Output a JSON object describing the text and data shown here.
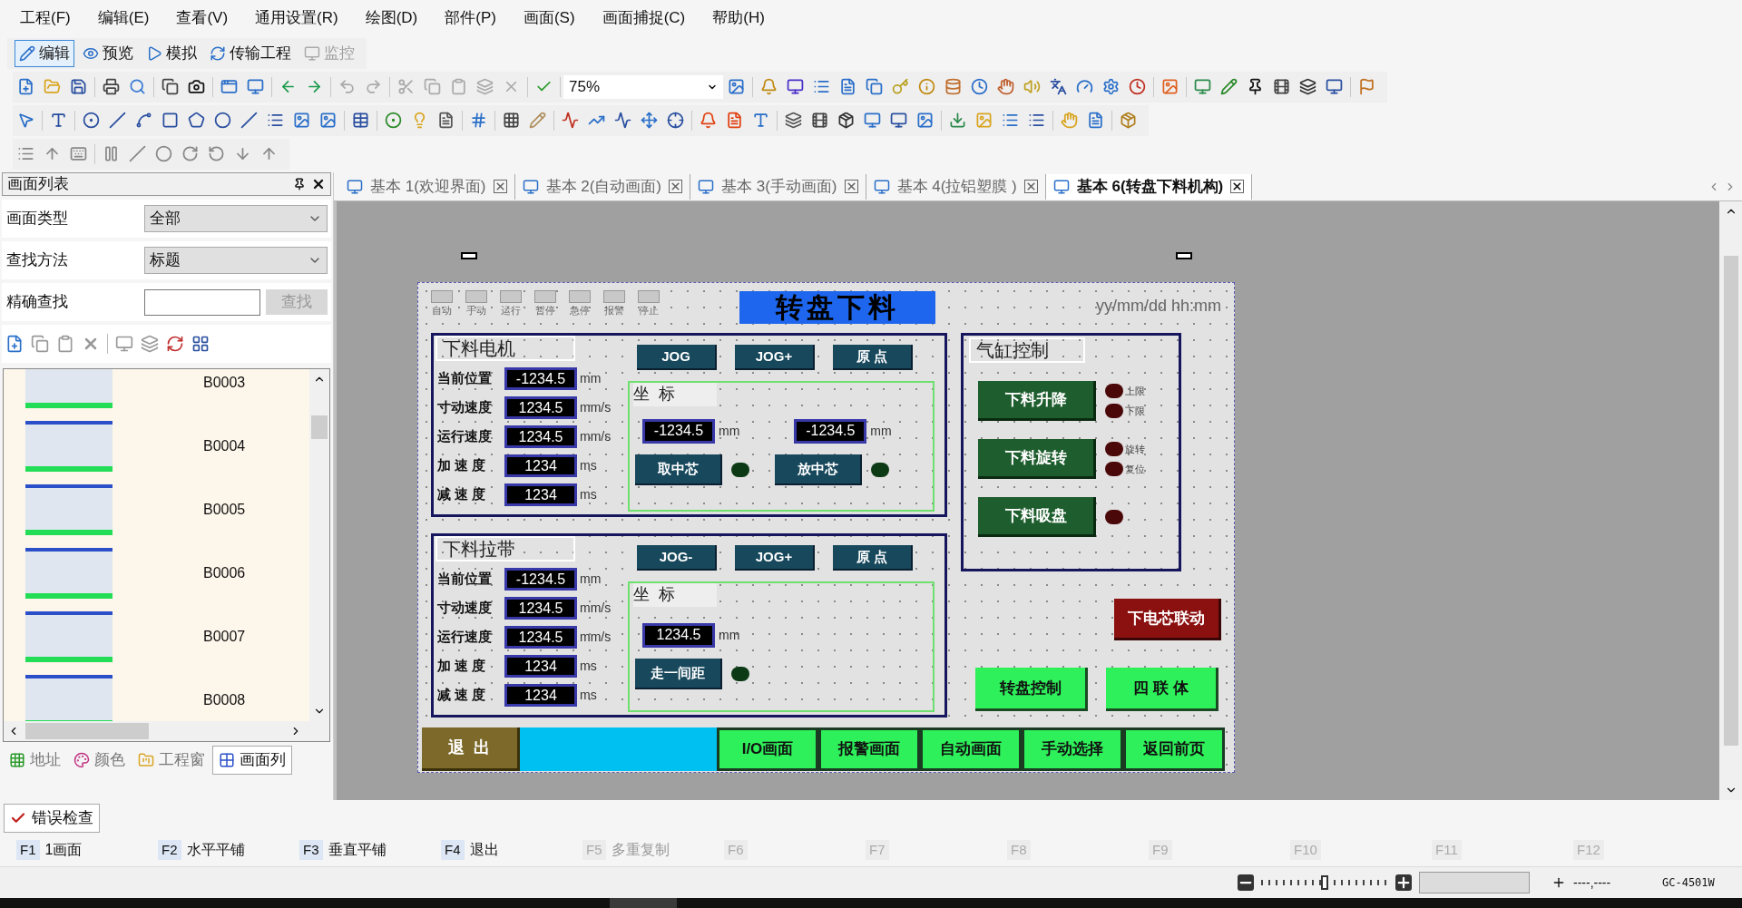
{
  "menu": [
    "工程(F)",
    "编辑(E)",
    "查看(V)",
    "通用设置(R)",
    "绘图(D)",
    "部件(P)",
    "画面(S)",
    "画面捕捉(C)",
    "帮助(H)"
  ],
  "mode_toolbar": [
    {
      "label": "编辑",
      "selected": true,
      "disabled": false
    },
    {
      "label": "预览",
      "selected": false,
      "disabled": false
    },
    {
      "label": "模拟",
      "selected": false,
      "disabled": false
    },
    {
      "label": "传输工程",
      "selected": false,
      "disabled": false
    },
    {
      "label": "监控",
      "selected": false,
      "disabled": true
    }
  ],
  "zoom_select": {
    "value": "75%"
  },
  "screen_list_panel": {
    "title": "画面列表",
    "filters": [
      {
        "label": "画面类型",
        "value": "全部"
      },
      {
        "label": "查找方法",
        "value": "标题"
      }
    ],
    "exact_search": {
      "label": "精确查找",
      "button": "查找"
    },
    "screens": [
      {
        "name": "B0003"
      },
      {
        "name": "B0004"
      },
      {
        "name": "B0005"
      },
      {
        "name": "B0006"
      },
      {
        "name": "B0007"
      },
      {
        "name": "B0008"
      }
    ],
    "bottom_tabs": [
      {
        "label": "地址",
        "selected": false
      },
      {
        "label": "颜色",
        "selected": false
      },
      {
        "label": "工程窗",
        "selected": false
      },
      {
        "label": "画面列",
        "selected": true
      }
    ]
  },
  "document_tabs": [
    {
      "label": "基本 1(欢迎界面)",
      "selected": false
    },
    {
      "label": "基本 2(自动画面)",
      "selected": false
    },
    {
      "label": "基本 3(手动画面)",
      "selected": false
    },
    {
      "label": "基本 4(拉铝塑膜 )",
      "selected": false
    },
    {
      "label": "基本 6(转盘下料机构)",
      "selected": true
    }
  ],
  "hmi_screen": {
    "indicators": [
      "自动",
      "手动",
      "运行",
      "暂停",
      "急停",
      "报警",
      "停止"
    ],
    "title": "转盘下料",
    "datetime": "yy/mm/dd hh:mm",
    "groups": [
      {
        "title": "下料电机",
        "params": [
          {
            "label": "当前位置",
            "value": "-1234.5",
            "unit": "mm"
          },
          {
            "label": "寸动速度",
            "value": "1234.5",
            "unit": "mm/s"
          },
          {
            "label": "运行速度",
            "value": "1234.5",
            "unit": "mm/s"
          },
          {
            "label": "加 速 度",
            "value": "1234",
            "unit": "ms"
          },
          {
            "label": "减 速 度",
            "value": "1234",
            "unit": "ms"
          }
        ],
        "buttons": [
          "JOG",
          "JOG+",
          "原 点"
        ],
        "coordinate": {
          "title": "坐  标",
          "fields": [
            {
              "value": "-1234.5",
              "unit": "mm"
            },
            {
              "value": "-1234.5",
              "unit": "mm"
            }
          ],
          "actions": [
            {
              "label": "取中芯",
              "on": false
            },
            {
              "label": "放中芯",
              "on": false
            }
          ]
        }
      },
      {
        "title": "下料拉带",
        "params": [
          {
            "label": "当前位置",
            "value": "-1234.5",
            "unit": "mm"
          },
          {
            "label": "寸动速度",
            "value": "1234.5",
            "unit": "mm/s"
          },
          {
            "label": "运行速度",
            "value": "1234.5",
            "unit": "mm/s"
          },
          {
            "label": "加 速 度",
            "value": "1234",
            "unit": "ms"
          },
          {
            "label": "减 速 度",
            "value": "1234",
            "unit": "ms"
          }
        ],
        "buttons": [
          "JOG-",
          "JOG+",
          "原 点"
        ],
        "coordinate": {
          "title": "坐  标",
          "fields": [
            {
              "value": "1234.5",
              "unit": "mm"
            }
          ],
          "actions": [
            {
              "label": "走一间距",
              "on": false
            }
          ]
        }
      }
    ],
    "cylinder_control": {
      "title": "气缸控制",
      "buttons": [
        {
          "label": "下料升降",
          "lamps": [
            {
              "label": "上限",
              "on": false
            },
            {
              "label": "下限",
              "on": false
            }
          ]
        },
        {
          "label": "下料旋转",
          "lamps": [
            {
              "label": "旋转",
              "on": false
            },
            {
              "label": "复位",
              "on": false
            }
          ]
        },
        {
          "label": "下料吸盘",
          "lamps": [
            {
              "on": false
            }
          ]
        }
      ]
    },
    "linkage_button": "下电芯联动",
    "side_buttons": [
      "转盘控制",
      "四 联 体"
    ],
    "exit_button": "退  出",
    "nav_buttons": [
      "I/O画面",
      "报警画面",
      "自动画面",
      "手动选择",
      "返回前页"
    ]
  },
  "output_tab": "错误检查",
  "function_keys": [
    {
      "key": "F1",
      "label": "1画面",
      "disabled": false
    },
    {
      "key": "F2",
      "label": "水平平铺",
      "disabled": false
    },
    {
      "key": "F3",
      "label": "垂直平铺",
      "disabled": false
    },
    {
      "key": "F4",
      "label": "退出",
      "disabled": false
    },
    {
      "key": "F5",
      "label": "多重复制",
      "disabled": true
    },
    {
      "key": "F6",
      "disabled": true
    },
    {
      "key": "F7",
      "disabled": true
    },
    {
      "key": "F8",
      "disabled": true
    },
    {
      "key": "F9",
      "disabled": true
    },
    {
      "key": "F10",
      "disabled": true
    },
    {
      "key": "F11",
      "disabled": true
    },
    {
      "key": "F12",
      "disabled": true
    }
  ],
  "status_bar": {
    "zoom_slider": {
      "level": 0.5
    },
    "coordinates": "----,----",
    "model": "GC-4501W"
  }
}
